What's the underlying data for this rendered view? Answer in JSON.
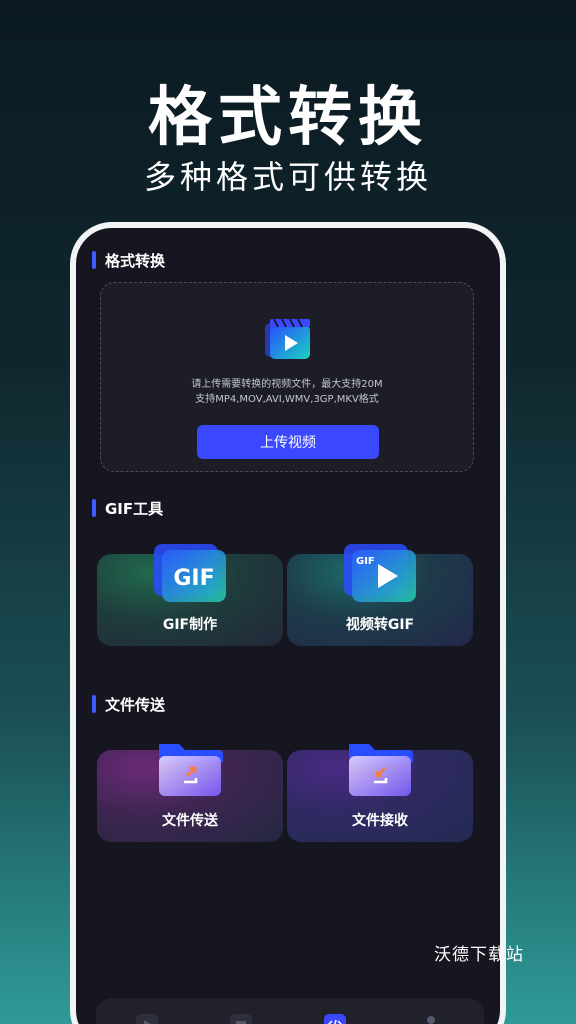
{
  "hero": {
    "title": "格式转换",
    "subtitle": "多种格式可供转换"
  },
  "convert": {
    "section_title": "格式转换",
    "description_line1": "请上传需要转换的视频文件，最大支持20M",
    "description_line2": "支持MP4,MOV,AVI,WMV,3GP,MKV格式",
    "upload_button": "上传视频"
  },
  "gif_tools": {
    "section_title": "GIF工具",
    "items": [
      {
        "label": "GIF制作",
        "icon": "gif-icon"
      },
      {
        "label": "视频转GIF",
        "icon": "video-to-gif-icon"
      }
    ]
  },
  "file_transfer": {
    "section_title": "文件传送",
    "items": [
      {
        "label": "文件传送",
        "icon": "folder-send-icon"
      },
      {
        "label": "文件接收",
        "icon": "folder-receive-icon"
      }
    ]
  },
  "tabbar": {
    "tabs": [
      {
        "icon": "video-tab-icon",
        "active": false
      },
      {
        "icon": "folder-tab-icon",
        "active": false
      },
      {
        "icon": "code-tab-icon",
        "active": true
      },
      {
        "icon": "profile-tab-icon",
        "active": false
      }
    ]
  },
  "watermark": "沃德下载站",
  "colors": {
    "accent": "#3a49ff",
    "background": "#15161f",
    "frame": "#f2f4f6"
  }
}
